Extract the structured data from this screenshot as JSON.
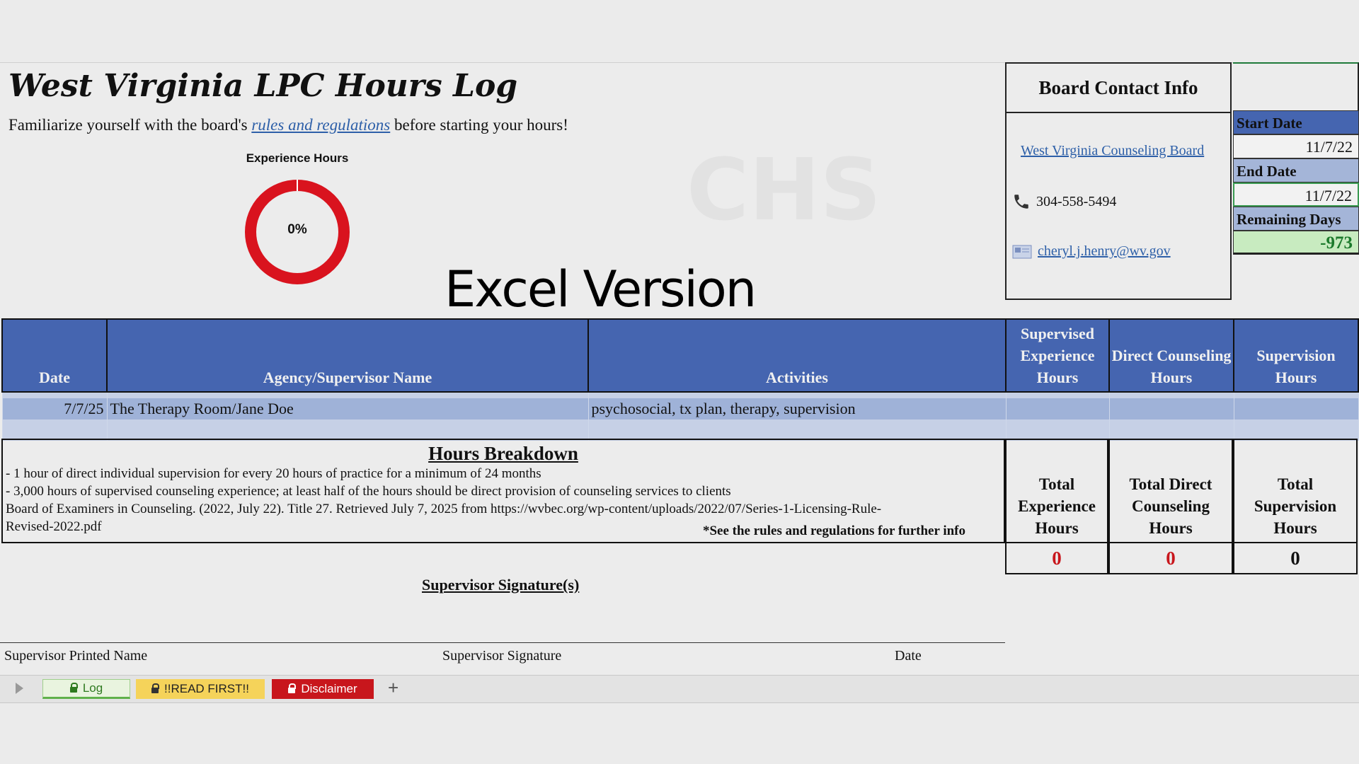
{
  "header": {
    "title": "West Virginia LPC Hours Log",
    "subtitle_before": "Familiarize yourself with the board's ",
    "subtitle_link": "rules and regulations",
    "subtitle_after": " before starting your hours!"
  },
  "gauge": {
    "label": "Experience Hours",
    "value_text": "0%",
    "progress": 0,
    "ring_color": "#d9131e"
  },
  "overlay_text": "Excel Version",
  "watermark": "CHS",
  "contact": {
    "title": "Board Contact Info",
    "board_link": "West Virginia Counseling Board",
    "phone": "304-558-5494",
    "email": "cheryl.j.henry@wv.gov"
  },
  "dates": {
    "start_label": "Start Date",
    "start_value": "11/7/22",
    "end_label": "End Date",
    "end_value": "11/7/22",
    "remaining_label": "Remaining Days",
    "remaining_value": "-973"
  },
  "log": {
    "columns": [
      "Date",
      "Agency/Supervisor Name",
      "Activities",
      "Supervised Experience Hours",
      "Direct Counseling Hours",
      "Supervision Hours"
    ],
    "rows": [
      {
        "date": "7/7/25",
        "agency": "The Therapy Room/Jane Doe",
        "activities": "psychosocial, tx plan, therapy, supervision",
        "supervised": "",
        "direct": "",
        "supervision": ""
      }
    ]
  },
  "breakdown": {
    "title": "Hours Breakdown",
    "line1": "- 1 hour of direct individual supervision for every 20 hours of practice for a minimum of 24 months",
    "line2": "- 3,000 hours of supervised counseling experience; at least half of the hours should be direct provision of counseling services to clients",
    "line3": "Board of Examiners in Counseling. (2022, July 22). Title 27. Retrieved July 7, 2025 from https://wvbec.org/wp-content/uploads/2022/07/Series-1-Licensing-Rule-",
    "line4": "Revised-2022.pdf",
    "note": "*See the rules and regulations for further info"
  },
  "totals": {
    "experience_label": "Total Experience Hours",
    "experience_value": "0",
    "direct_label": "Total Direct Counseling Hours",
    "direct_value": "0",
    "supervision_label": "Total Supervision Hours",
    "supervision_value": "0"
  },
  "signature": {
    "title": "Supervisor Signature(s)",
    "printed_name": "Supervisor Printed Name",
    "signature": "Supervisor Signature",
    "date": "Date"
  },
  "tabs": {
    "log": "Log",
    "read_first": "!!READ FIRST!!",
    "disclaimer": "Disclaimer",
    "add": "+"
  }
}
